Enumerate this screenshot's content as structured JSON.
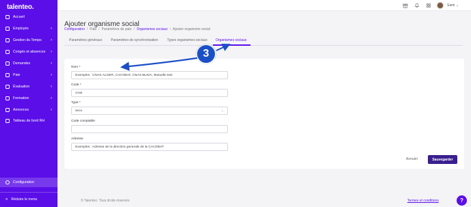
{
  "sidebar": {
    "logo": "talenteo.",
    "items": [
      {
        "label": "Accueil",
        "icon": "home-icon",
        "chevron": ""
      },
      {
        "label": "Employés",
        "icon": "users-icon",
        "chevron": "›"
      },
      {
        "label": "Gestion du Temps",
        "icon": "clock-icon",
        "chevron": "›"
      },
      {
        "label": "Congés et absences",
        "icon": "calendar-icon",
        "chevron": "›"
      },
      {
        "label": "Demandes",
        "icon": "inbox-icon",
        "chevron": "›"
      },
      {
        "label": "Paie",
        "icon": "wallet-icon",
        "chevron": "›"
      },
      {
        "label": "Évaluation",
        "icon": "target-icon",
        "chevron": "›"
      },
      {
        "label": "Formation",
        "icon": "book-icon",
        "chevron": "›"
      },
      {
        "label": "Annonces",
        "icon": "megaphone-icon",
        "chevron": "›"
      },
      {
        "label": "Tableau de bord RH",
        "icon": "dashboard-icon",
        "chevron": ""
      }
    ],
    "config": "Configuration",
    "reduce": "Réduire le menu"
  },
  "topbar": {
    "username": "Sami",
    "icons": [
      "gift-icon",
      "bell-icon",
      "apps-icon"
    ]
  },
  "header": {
    "title": "Ajouter organisme social",
    "breadcrumb": [
      "Configuration",
      "Paie",
      "Paramètres de paie",
      "Organismes sociaux",
      "Ajouter organisme social"
    ]
  },
  "tabs": [
    "Paramètres généraux",
    "Paramètres de synchronisation",
    "Types organismes sociaux",
    "Organismes sociaux"
  ],
  "form": {
    "nom_label": "Nom *",
    "nom_value": "Exemples : CNAS ALGER, CACOBAT, CNAS BLIDA, Mutuelle test",
    "code_label": "Code *",
    "code_value": "cnas",
    "type_label": "Type *",
    "type_value": "secu",
    "compta_label": "Code comptable",
    "compta_value": "",
    "adresse_label": "Adresse",
    "adresse_value": "Exemples : Adresse de la direction generale de la CACOBAT"
  },
  "actions": {
    "cancel": "Annuler",
    "save": "Sauvegarder"
  },
  "annotation": {
    "step": "3"
  },
  "footer": {
    "copyright": "© Talenteo. Tous droits réservés",
    "terms": "Termes et conditions",
    "help": "?"
  },
  "colors": {
    "brand": "#5b0ee8",
    "save_button": "#3a1f8f",
    "annotation": "#1b4fc6"
  }
}
